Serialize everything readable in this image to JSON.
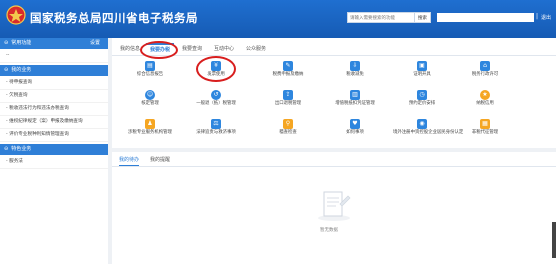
{
  "header": {
    "title": "国家税务总局四川省电子税务局",
    "search_placeholder": "请输入需要搜索的功能",
    "search_button": "搜索",
    "separator": "|",
    "logout": "退出"
  },
  "sidebar": {
    "common_functions": {
      "label": "常用功能",
      "set_label": "设置",
      "items": [
        "--"
      ]
    },
    "my_business": {
      "label": "我的业务",
      "items": [
        "- 待申报查询",
        "- 欠税查询",
        "- 税收违法行为和违法办税查询",
        "- 维权纪律规定（案）申报及缴纳查询",
        "- 评价专业税种利知情管理查询"
      ]
    },
    "specific_business": {
      "label": "特色业务",
      "items": [
        "- 服务法"
      ]
    }
  },
  "tabs": [
    "我的信息",
    "我要办税",
    "我要查询",
    "互动中心",
    "公众服务"
  ],
  "active_tab": 1,
  "tiles": [
    {
      "label": "综合信息报告",
      "icon": "doc-icon"
    },
    {
      "label": "发票使用",
      "icon": "invoice-icon"
    },
    {
      "label": "税费申报及缴纳",
      "icon": "tax-declare-icon"
    },
    {
      "label": "税收减免",
      "icon": "tax-reduce-icon"
    },
    {
      "label": "证明开具",
      "icon": "certificate-icon"
    },
    {
      "label": "税务行政许可",
      "icon": "permit-icon"
    },
    {
      "label": "核定管理",
      "icon": "approve-icon"
    },
    {
      "label": "一般退（抵）税管理",
      "icon": "refund-icon"
    },
    {
      "label": "出口退税管理",
      "icon": "export-refund-icon"
    },
    {
      "label": "增值税抵扣凭证管理",
      "icon": "vat-deduct-icon"
    },
    {
      "label": "预约定价安排",
      "icon": "pricing-icon"
    },
    {
      "label": "纳税信用",
      "icon": "credit-icon"
    },
    {
      "label": "涉税专业服务机构管理",
      "icon": "agency-icon"
    },
    {
      "label": "法律追责与救济事项",
      "icon": "legal-icon"
    },
    {
      "label": "稽查检查",
      "icon": "inspection-icon"
    },
    {
      "label": "如何事项",
      "icon": "help-icon"
    },
    {
      "label": "境外注册中资控股企业居民身份认定",
      "icon": "resident-icon"
    },
    {
      "label": "非税代征管理",
      "icon": "nontax-icon"
    }
  ],
  "bottom_tabs": [
    "我的待办",
    "我的提醒"
  ],
  "active_bottom_tab": 0,
  "empty_text": "暂无数据",
  "colors": {
    "header": "#1f6fd0",
    "accent": "#2f7fd7",
    "annotation": "#d81e1e",
    "icon_blue": "#2e86de",
    "icon_orange": "#f5a623"
  }
}
